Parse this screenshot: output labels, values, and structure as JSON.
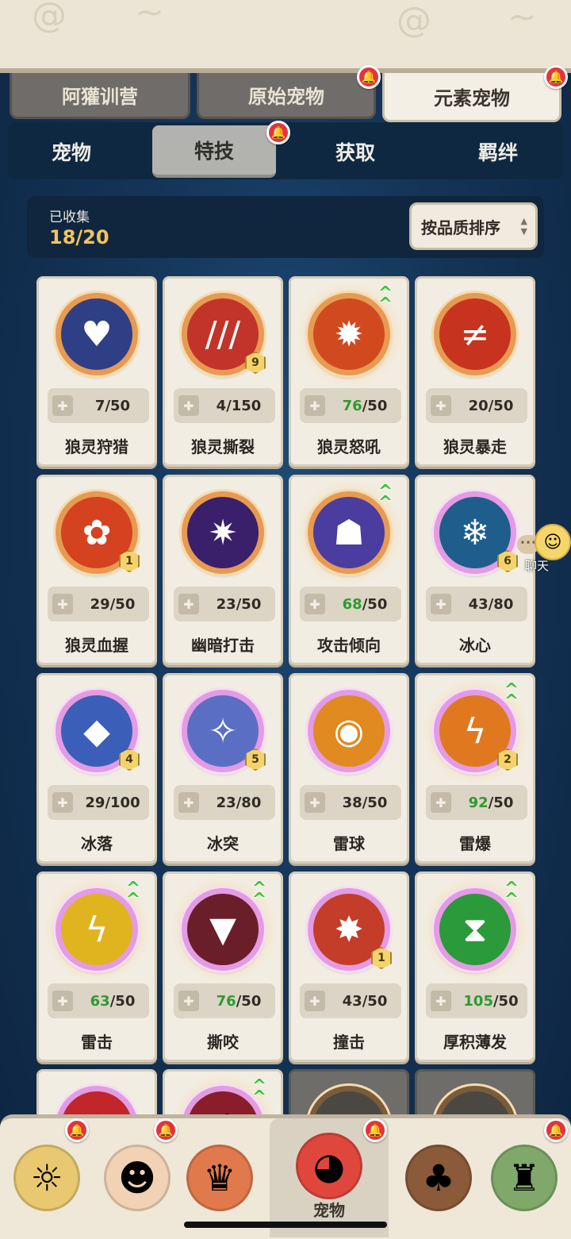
{
  "main_tabs": [
    {
      "label": "阿獾训营",
      "active": false
    },
    {
      "label": "原始宠物",
      "active": false
    },
    {
      "label": "元素宠物",
      "active": true
    }
  ],
  "sub_tabs": [
    {
      "label": "宠物",
      "active": false
    },
    {
      "label": "特技",
      "active": true
    },
    {
      "label": "获取",
      "active": false
    },
    {
      "label": "羁绊",
      "active": false
    }
  ],
  "collection": {
    "label": "已收集",
    "count": "18/20"
  },
  "sort_button": {
    "label": "按品质排序"
  },
  "skills": [
    {
      "name": "狼灵狩猎",
      "have": "7",
      "need": "/50",
      "ring": "orange",
      "icon": "crest-icon",
      "level": "",
      "upgrade": false
    },
    {
      "name": "狼灵撕裂",
      "have": "4",
      "need": "/150",
      "ring": "orange",
      "icon": "claw-slash-icon",
      "level": "9",
      "upgrade": false
    },
    {
      "name": "狼灵怒吼",
      "have": "76",
      "need": "/50",
      "ring": "orange",
      "icon": "fire-roar-icon",
      "level": "",
      "upgrade": true
    },
    {
      "name": "狼灵暴走",
      "have": "20",
      "need": "/50",
      "ring": "orange",
      "icon": "rampage-slash-icon",
      "level": "",
      "upgrade": false
    },
    {
      "name": "狼灵血握",
      "have": "29",
      "need": "/50",
      "ring": "orange",
      "icon": "paw-icon",
      "level": "1",
      "upgrade": false
    },
    {
      "name": "幽暗打击",
      "have": "23",
      "need": "/50",
      "ring": "orange",
      "icon": "dark-strike-icon",
      "level": "",
      "upgrade": false
    },
    {
      "name": "攻击倾向",
      "have": "68",
      "need": "/50",
      "ring": "orange",
      "icon": "ghost-mask-icon",
      "level": "",
      "upgrade": true
    },
    {
      "name": "冰心",
      "have": "43",
      "need": "/80",
      "ring": "pink",
      "icon": "snowflake-icon",
      "level": "6",
      "upgrade": false
    },
    {
      "name": "冰落",
      "have": "29",
      "need": "/100",
      "ring": "pink",
      "icon": "ice-shard-icon",
      "level": "4",
      "upgrade": false
    },
    {
      "name": "冰突",
      "have": "23",
      "need": "/80",
      "ring": "pink",
      "icon": "ice-crystal-icon",
      "level": "5",
      "upgrade": false
    },
    {
      "name": "雷球",
      "have": "38",
      "need": "/50",
      "ring": "pink",
      "icon": "thunder-orb-icon",
      "level": "",
      "upgrade": false
    },
    {
      "name": "雷爆",
      "have": "92",
      "need": "/50",
      "ring": "pink",
      "icon": "lightning-burst-icon",
      "level": "2",
      "upgrade": true
    },
    {
      "name": "雷击",
      "have": "63",
      "need": "/50",
      "ring": "pink",
      "icon": "thunder-strike-icon",
      "level": "",
      "upgrade": true
    },
    {
      "name": "撕咬",
      "have": "76",
      "need": "/50",
      "ring": "pink",
      "icon": "bite-icon",
      "level": "",
      "upgrade": true
    },
    {
      "name": "撞击",
      "have": "43",
      "need": "/50",
      "ring": "pink",
      "icon": "impact-icon",
      "level": "1",
      "upgrade": false
    },
    {
      "name": "厚积薄发",
      "have": "105",
      "need": "/50",
      "ring": "pink",
      "icon": "hourglass-icon",
      "level": "",
      "upgrade": true
    }
  ],
  "chat": {
    "label": "聊天"
  },
  "bottom_nav": [
    {
      "label": "",
      "icon": "character-straw-icon"
    },
    {
      "label": "",
      "icon": "character-boy-icon"
    },
    {
      "label": "",
      "icon": "character-tribal-icon"
    },
    {
      "label": "宠物",
      "icon": "pet-dino-icon"
    },
    {
      "label": "",
      "icon": "bear-village-icon"
    },
    {
      "label": "",
      "icon": "stone-totem-icon"
    }
  ],
  "colors": {
    "progress_ok": "#2e9a32",
    "bell": "#e5333c",
    "accent_count": "#f3c35c"
  }
}
